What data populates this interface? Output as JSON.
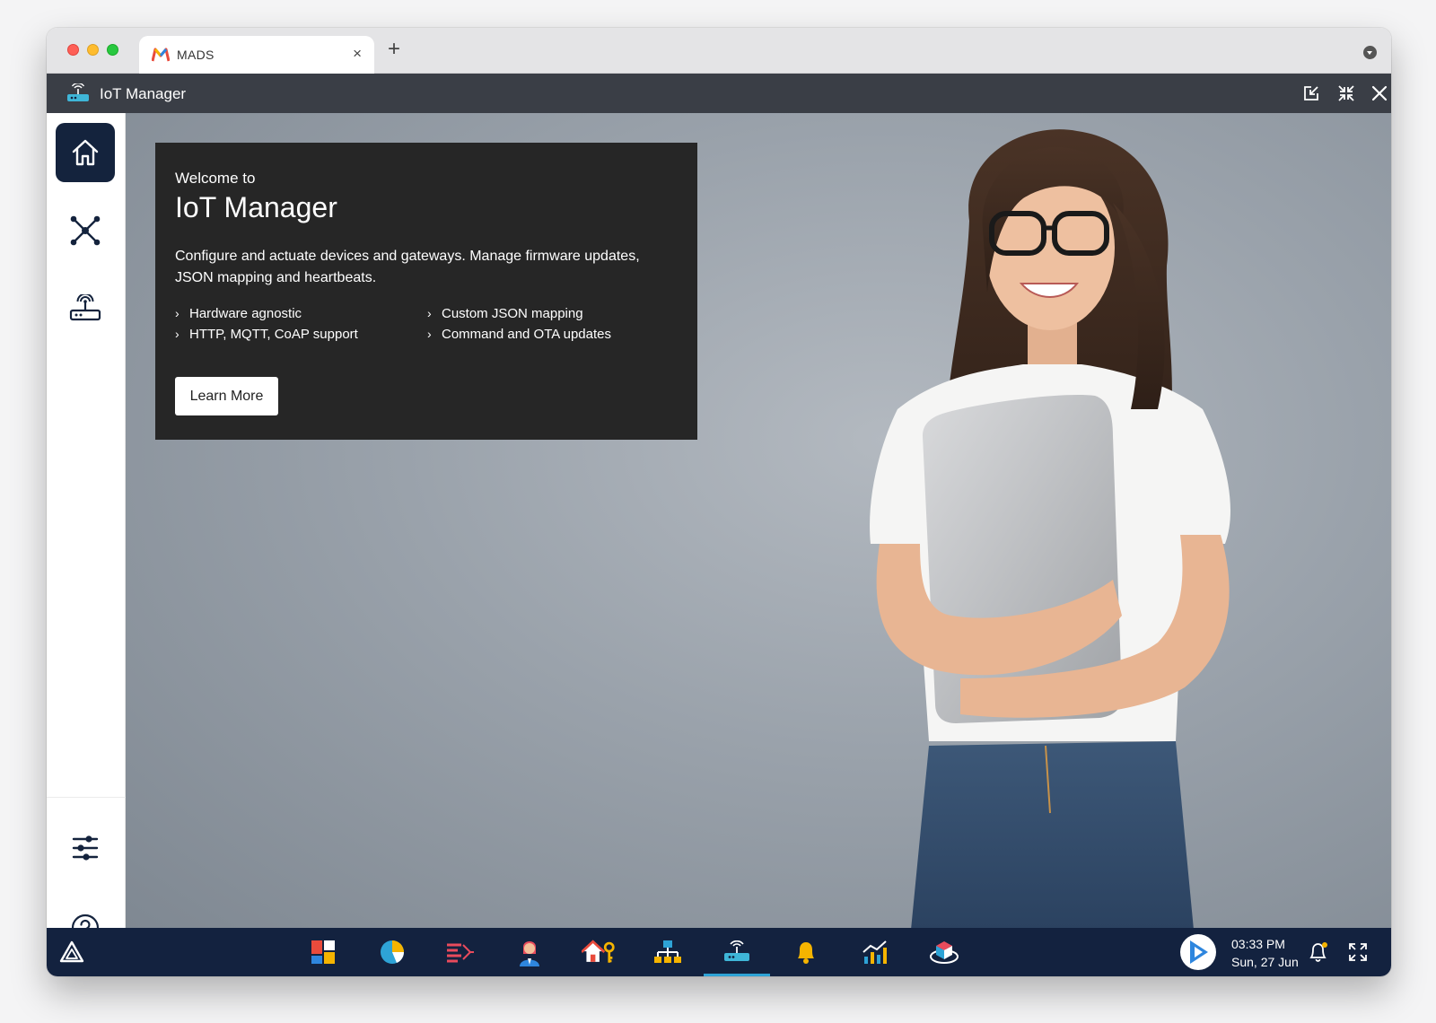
{
  "browser": {
    "tab_title": "MADS",
    "tab_close": "×",
    "new_tab": "+"
  },
  "app": {
    "title": "IoT Manager"
  },
  "welcome": {
    "subtitle": "Welcome to",
    "title": "IoT Manager",
    "description": "Configure and actuate devices and gateways. Manage firmware updates, JSON mapping and heartbeats.",
    "features": [
      "Hardware agnostic",
      "HTTP, MQTT, CoAP support",
      "Custom JSON mapping",
      "Command and OTA updates"
    ],
    "chevron": "›",
    "learn_more": "Learn More"
  },
  "sidebar": {
    "items": [
      {
        "icon": "home-icon",
        "active": true
      },
      {
        "icon": "network-nodes-icon",
        "active": false
      },
      {
        "icon": "gateway-router-icon",
        "active": false
      }
    ],
    "bottom": [
      {
        "icon": "sliders-icon"
      },
      {
        "icon": "help-icon"
      }
    ]
  },
  "taskbar": {
    "apps": [
      "dashboard-app-icon",
      "analytics-pie-app-icon",
      "data-flow-app-icon",
      "user-profile-app-icon",
      "home-key-app-icon",
      "hierarchy-app-icon",
      "iot-manager-app-icon",
      "alerts-bell-app-icon",
      "trends-chart-app-icon",
      "cube-app-icon"
    ],
    "active_app": "iot-manager-app-icon",
    "time": "03:33 PM",
    "date": "Sun, 27 Jun"
  },
  "colors": {
    "header": "#3a3e46",
    "sidebar_active": "#14233d",
    "taskbar": "#13223f",
    "welcome_card": "#262626",
    "accent": "#2ea3d6"
  }
}
